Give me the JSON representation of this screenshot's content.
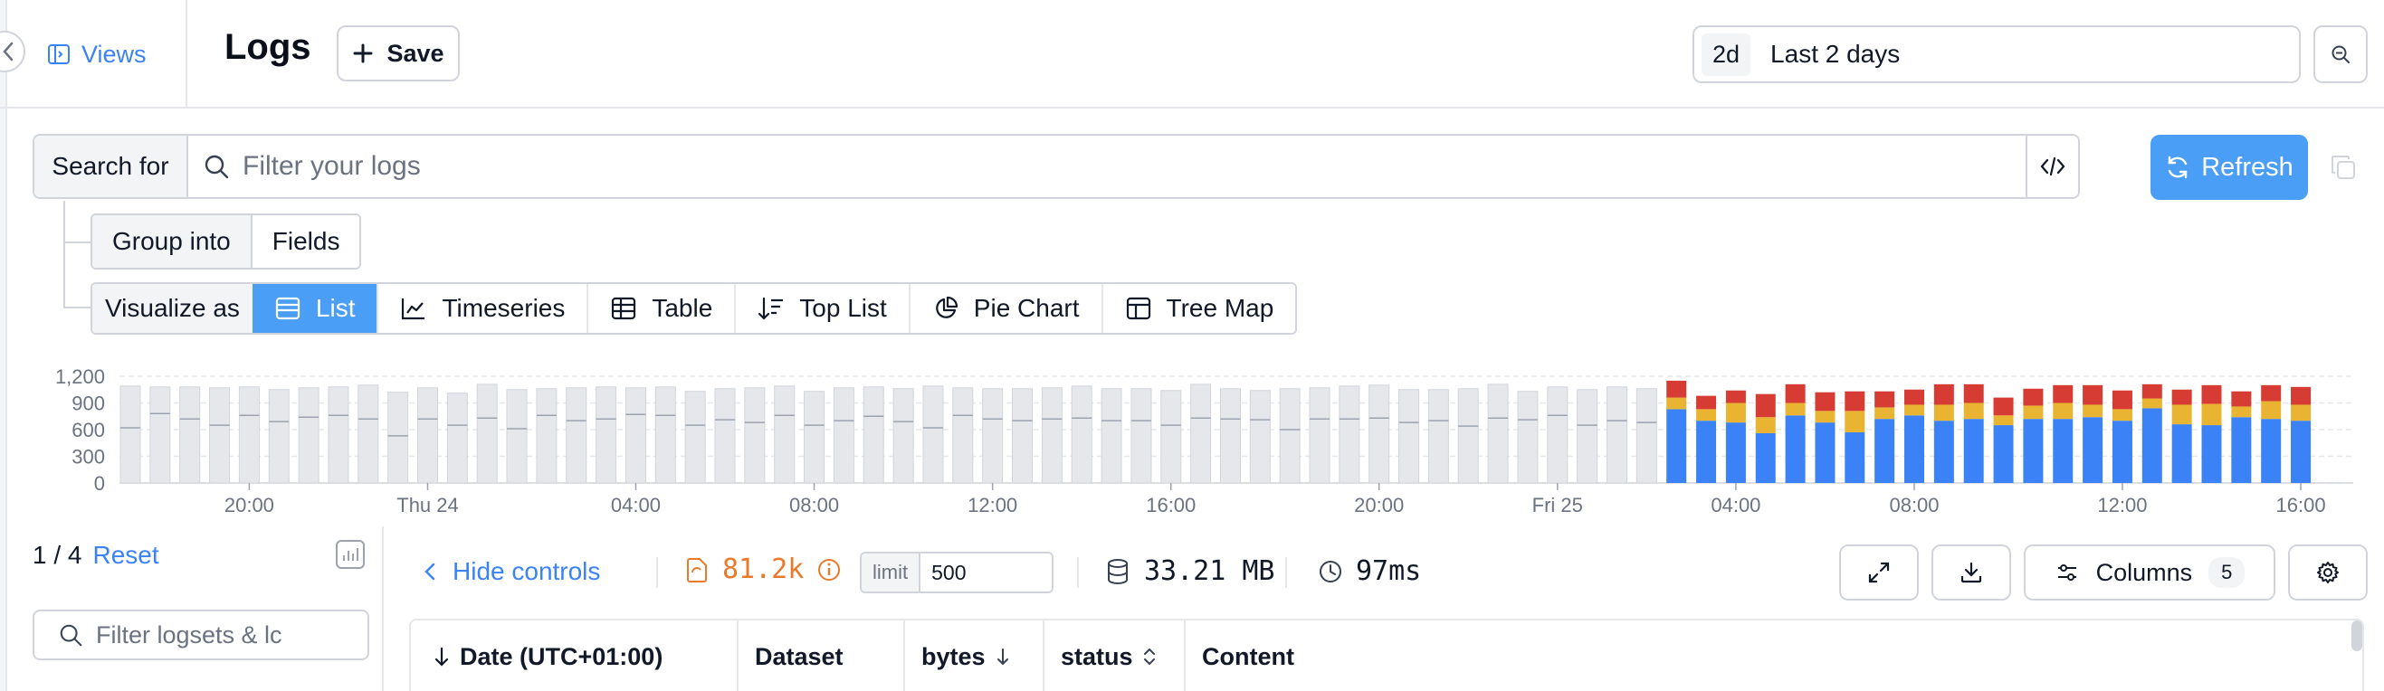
{
  "header": {
    "views_label": "Views",
    "title": "Logs",
    "save_label": "Save",
    "time_chip": "2d",
    "time_label": "Last 2 days"
  },
  "search": {
    "label": "Search for",
    "placeholder": "Filter your logs",
    "refresh_label": "Refresh"
  },
  "group_into": {
    "label": "Group into",
    "value": "Fields"
  },
  "visualize": {
    "label": "Visualize as",
    "options": [
      "List",
      "Timeseries",
      "Table",
      "Top List",
      "Pie Chart",
      "Tree Map"
    ],
    "active": "List"
  },
  "chart_data": {
    "type": "bar",
    "stacked": true,
    "y_ticks": [
      "0",
      "300",
      "600",
      "900",
      "1,200"
    ],
    "ylim": [
      0,
      1200
    ],
    "x_ticks": [
      {
        "label": "20:00",
        "index": 4
      },
      {
        "label": "Thu 24",
        "index": 10
      },
      {
        "label": "04:00",
        "index": 17
      },
      {
        "label": "08:00",
        "index": 23
      },
      {
        "label": "12:00",
        "index": 29
      },
      {
        "label": "16:00",
        "index": 35
      },
      {
        "label": "20:00",
        "index": 42
      },
      {
        "label": "Fri 25",
        "index": 48
      },
      {
        "label": "04:00",
        "index": 54
      },
      {
        "label": "08:00",
        "index": 60
      },
      {
        "label": "12:00",
        "index": 67
      },
      {
        "label": "16:00",
        "index": 73
      }
    ],
    "grid": true,
    "colors": {
      "inactive": "#e5e7eb",
      "blue": "#3b82f6",
      "yellow": "#e8b431",
      "red": "#d63b34"
    },
    "inactive_series": {
      "name": "",
      "values": [
        1090,
        1080,
        1080,
        1070,
        1080,
        1050,
        1070,
        1080,
        1100,
        1020,
        1070,
        1010,
        1110,
        1050,
        1060,
        1070,
        1080,
        1070,
        1080,
        1030,
        1060,
        1070,
        1090,
        1030,
        1070,
        1080,
        1060,
        1090,
        1070,
        1060,
        1060,
        1070,
        1090,
        1060,
        1060,
        1040,
        1110,
        1060,
        1040,
        1060,
        1070,
        1090,
        1100,
        1050,
        1050,
        1060,
        1110,
        1030,
        1080,
        1050,
        1080,
        1060
      ],
      "mids": [
        620,
        780,
        720,
        650,
        760,
        690,
        740,
        760,
        720,
        530,
        720,
        650,
        730,
        610,
        760,
        700,
        720,
        770,
        760,
        650,
        710,
        680,
        760,
        650,
        700,
        750,
        690,
        620,
        760,
        720,
        700,
        720,
        730,
        700,
        700,
        650,
        730,
        720,
        710,
        600,
        720,
        720,
        730,
        680,
        700,
        640,
        730,
        710,
        760,
        650,
        700,
        680
      ]
    },
    "series": [
      {
        "name": "",
        "values": [
          830,
          700,
          680,
          560,
          760,
          680,
          570,
          720,
          760,
          700,
          720,
          650,
          720,
          720,
          740,
          700,
          840,
          660,
          650,
          740,
          720,
          700
        ]
      },
      {
        "name": "",
        "values": [
          130,
          130,
          220,
          180,
          140,
          130,
          240,
          130,
          120,
          180,
          180,
          110,
          150,
          180,
          140,
          130,
          110,
          220,
          240,
          120,
          200,
          180
        ]
      },
      {
        "name": "",
        "values": [
          190,
          150,
          140,
          260,
          210,
          210,
          220,
          180,
          170,
          230,
          210,
          200,
          190,
          200,
          220,
          210,
          160,
          170,
          210,
          170,
          180,
          200
        ]
      }
    ]
  },
  "left_panel": {
    "pagination": "1 / 4",
    "reset_label": "Reset",
    "filter_placeholder": "Filter logsets & lc"
  },
  "stats": {
    "hide_controls": "Hide controls",
    "count": "81.2k",
    "limit_label": "limit",
    "limit_value": "500",
    "size": "33.21 MB",
    "time": "97ms",
    "columns_label": "Columns",
    "columns_count": "5"
  },
  "table": {
    "columns": [
      "Date (UTC+01:00)",
      "Dataset",
      "bytes",
      "status",
      "Content"
    ]
  }
}
